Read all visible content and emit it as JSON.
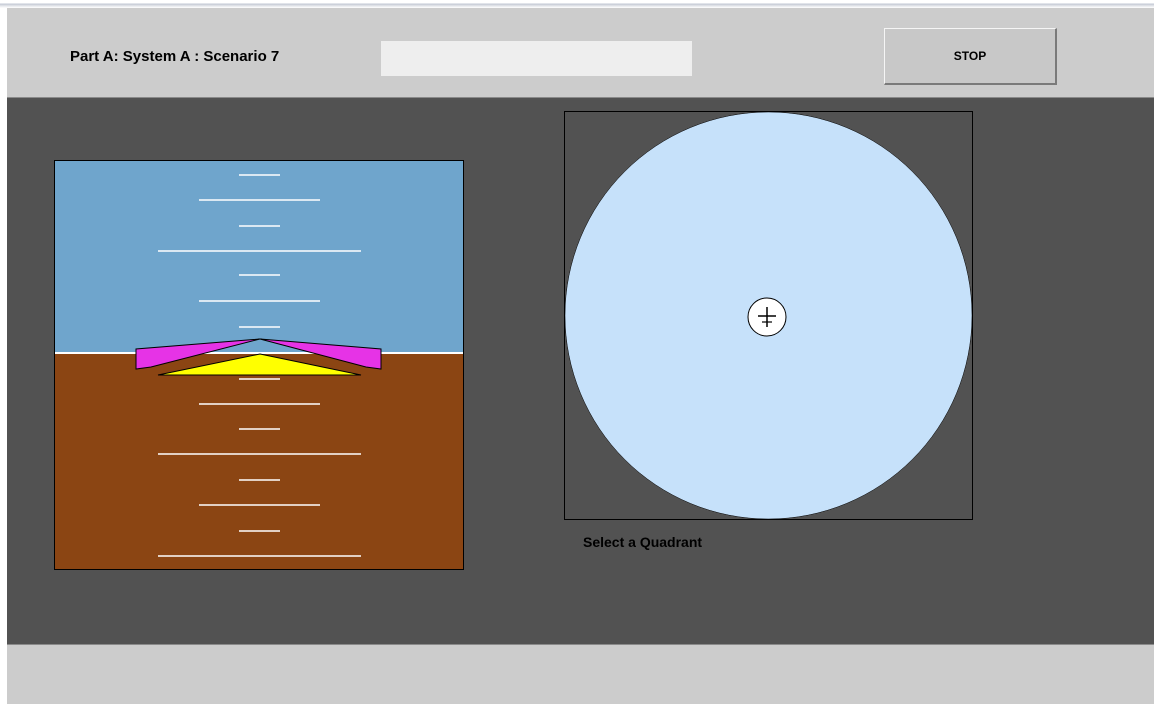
{
  "header": {
    "title": "Part A: System A : Scenario 7",
    "status_value": "",
    "stop_label": "STOP"
  },
  "attitude_indicator": {
    "sky_color": "#6fa5cc",
    "ground_color": "#8b4513",
    "horizon_line_color": "#ffffff",
    "pitch_line_color": "#ffffff",
    "aircraft_wings_color": "#e633e6",
    "aircraft_symbol_color": "#ffff00"
  },
  "quadrant": {
    "label": "Select a Quadrant",
    "disc_color": "#c6e1fa",
    "center_marker_icon": "crosshair-icon"
  },
  "colors": {
    "chrome": "#cccccc",
    "workspace": "#525252",
    "field": "#eeeeee"
  }
}
